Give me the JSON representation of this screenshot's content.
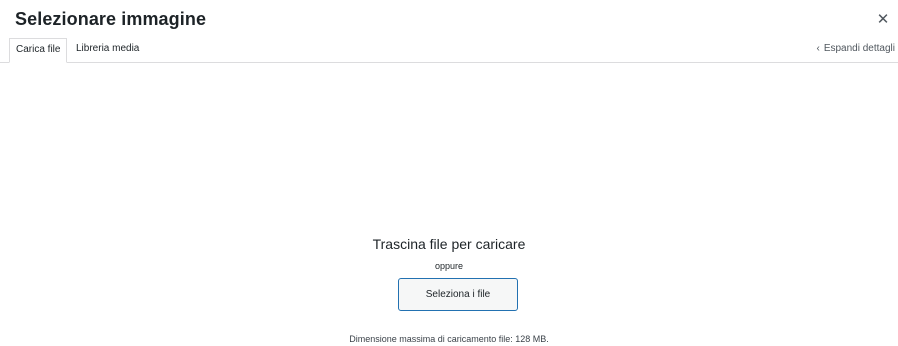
{
  "modal": {
    "title": "Selezionare immagine",
    "close_icon": "close-icon"
  },
  "tabs": [
    {
      "label": "Carica file",
      "active": true
    },
    {
      "label": "Libreria media",
      "active": false
    }
  ],
  "expand": {
    "label": "Espandi dettagli",
    "icon": "chevron-left-icon"
  },
  "uploader": {
    "drop_text": "Trascina file per caricare",
    "or_text": "oppure",
    "select_button": "Seleziona i file",
    "max_size_text": "Dimensione massima di caricamento file: 128 MB."
  },
  "colors": {
    "accent": "#2271b1",
    "text": "#1d2327",
    "border": "#dcdcde"
  }
}
